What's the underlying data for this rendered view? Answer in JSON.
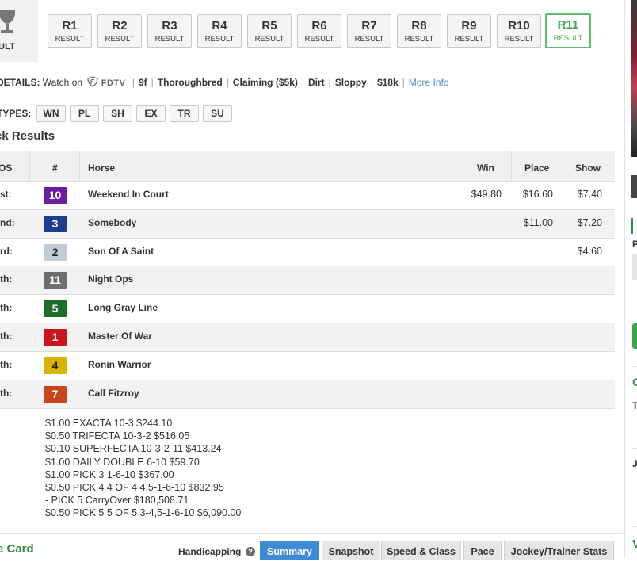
{
  "race_selector": {
    "trophy_label": "ULT",
    "races": [
      {
        "num": "R1",
        "label": "RESULT"
      },
      {
        "num": "R2",
        "label": "RESULT"
      },
      {
        "num": "R3",
        "label": "RESULT"
      },
      {
        "num": "R4",
        "label": "RESULT"
      },
      {
        "num": "R5",
        "label": "RESULT"
      },
      {
        "num": "R6",
        "label": "RESULT"
      },
      {
        "num": "R7",
        "label": "RESULT"
      },
      {
        "num": "R8",
        "label": "RESULT"
      },
      {
        "num": "R9",
        "label": "RESULT"
      },
      {
        "num": "R10",
        "label": "RESULT"
      },
      {
        "num": "R11",
        "label": "RESULT",
        "active": true
      }
    ]
  },
  "details": {
    "label": "DETAILS:",
    "watch_on": "Watch on",
    "fdtv": "FDTV",
    "distance": "9f",
    "breed": "Thoroughbred",
    "race_type": "Claiming ($5k)",
    "surface": "Dirt",
    "condition": "Sloppy",
    "purse": "$18k",
    "more_info": "More Info"
  },
  "bet_types": {
    "label": "TYPES:",
    "items": [
      "WN",
      "PL",
      "SH",
      "EX",
      "TR",
      "SU"
    ]
  },
  "results": {
    "title": "ck Results",
    "headers": {
      "pos": "OS",
      "num": "#",
      "horse": "Horse",
      "win": "Win",
      "place": "Place",
      "show": "Show"
    },
    "rows": [
      {
        "pos": "st:",
        "num": "10",
        "color": "#6a1fa0",
        "horse": "Weekend In Court",
        "win": "$49.80",
        "place": "$16.60",
        "show": "$7.40"
      },
      {
        "pos": "nd:",
        "num": "3",
        "color": "#1f3d8f",
        "horse": "Somebody",
        "win": "",
        "place": "$11.00",
        "show": "$7.20"
      },
      {
        "pos": "rd:",
        "num": "2",
        "color": "#c2ccd6",
        "text_color": "#222",
        "horse": "Son Of A Saint",
        "win": "",
        "place": "",
        "show": "$4.60"
      },
      {
        "pos": "th:",
        "num": "11",
        "color": "#6e6e6e",
        "horse": "Night Ops",
        "win": "",
        "place": "",
        "show": ""
      },
      {
        "pos": "th:",
        "num": "5",
        "color": "#1e6e2c",
        "horse": "Long Gray Line",
        "win": "",
        "place": "",
        "show": ""
      },
      {
        "pos": "th:",
        "num": "1",
        "color": "#c8161a",
        "horse": "Master Of War",
        "win": "",
        "place": "",
        "show": ""
      },
      {
        "pos": "th:",
        "num": "4",
        "color": "#d6b400",
        "text_color": "#222",
        "horse": "Ronin Warrior",
        "win": "",
        "place": "",
        "show": ""
      },
      {
        "pos": "th:",
        "num": "7",
        "color": "#c8461c",
        "horse": "Call Fitzroy",
        "win": "",
        "place": "",
        "show": ""
      }
    ]
  },
  "payouts": [
    "$1.00 EXACTA 10-3 $244.10",
    "$0.50 TRIFECTA 10-3-2 $516.05",
    "$0.10 SUPERFECTA 10-3-2-11 $413.24",
    "$1.00 DAILY DOUBLE 6-10 $59.70",
    "$1.00 PICK 3 1-6-10 $367.00",
    "$0.50 PICK 4 4 OF 4 4,5-1-6-10 $832.95",
    "- PICK 5 CarryOver $180,508.71",
    "$0.50 PICK 5 5 OF 5 3-4,5-1-6-10 $6,090.00"
  ],
  "bottom": {
    "card_title": "e Card",
    "handicapping_label": "Handicapping",
    "help_glyph": "?",
    "tabs": [
      {
        "label": "Summary",
        "active": true
      },
      {
        "label": "Snapshot"
      },
      {
        "label": "Speed & Class"
      },
      {
        "label": "Pace"
      },
      {
        "label": "Jockey/Trainer Stats"
      }
    ]
  },
  "sidebar": {
    "p_text": "P",
    "c_text": "C",
    "t_text": "T",
    "j_text": "J",
    "w_text": "V"
  }
}
